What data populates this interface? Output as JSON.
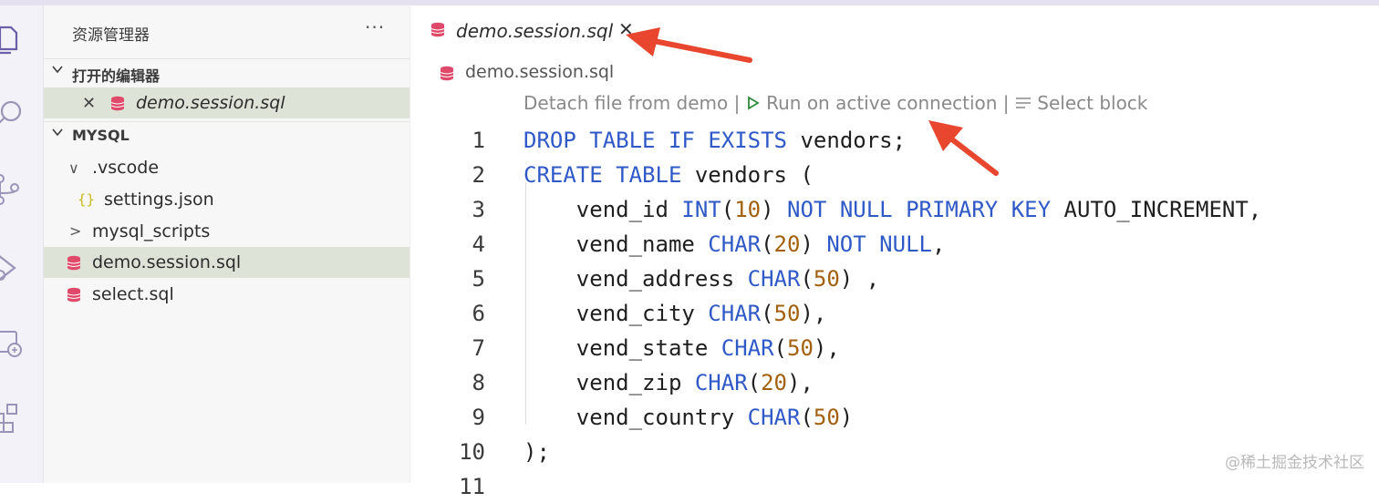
{
  "sidebar": {
    "title": "资源管理器",
    "more": "···",
    "open_editors": {
      "label": "打开的编辑器",
      "items": [
        {
          "close": "✕",
          "label": "demo.session.sql"
        }
      ]
    },
    "workspace": {
      "label": "MYSQL",
      "items": [
        {
          "chevron": "∨",
          "label": ".vscode"
        },
        {
          "icon_text": "{}",
          "label": "settings.json"
        },
        {
          "chevron": ">",
          "label": "mysql_scripts"
        },
        {
          "label": "demo.session.sql"
        },
        {
          "label": "select.sql"
        }
      ]
    }
  },
  "editor": {
    "tab": {
      "label": "demo.session.sql",
      "close": "✕"
    },
    "breadcrumb": "demo.session.sql",
    "codelens": {
      "detach": "Detach file from demo",
      "sep1": "|",
      "run": "Run on active connection",
      "sep2": "|",
      "select": "Select block"
    },
    "line_numbers": [
      "1",
      "2",
      "3",
      "4",
      "5",
      "6",
      "7",
      "8",
      "9",
      "10",
      "11"
    ]
  },
  "watermark": "@稀土掘金技术社区",
  "colors": {
    "keyword": "#2f59c7",
    "number": "#a3600e",
    "db_icon": "#e04a6a",
    "selection": "#dde3d6",
    "arrow": "#e8462e"
  }
}
